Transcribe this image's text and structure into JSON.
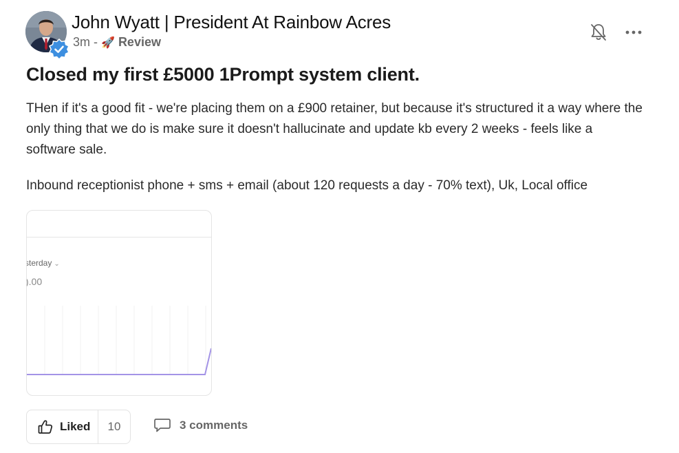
{
  "post": {
    "author": {
      "name": "John Wyatt | President At Rainbow Acres",
      "avatar_icon": "profile-photo",
      "verified_icon": "verified-badge-icon",
      "verified_color": "#3d8fe0"
    },
    "meta": {
      "time_ago": "3m",
      "separator": "-",
      "category_icon": "rocket",
      "category_glyph": "🚀",
      "category": "Review"
    },
    "actions": {
      "notifications_icon": "bell-off-icon",
      "more_icon": "more-horizontal-icon"
    },
    "title": "Closed my first £5000 1Prompt system client.",
    "body": [
      "THen if it's a good fit - we're placing them on a £900 retainer, but because it's structured it a way where the only thing that we do is make sure it doesn't hallucinate and update kb every 2 weeks - feels like a software sale.",
      "Inbound receptionist phone + sms + email (about 120 requests a day - 70% text), Uk, Local office"
    ],
    "attachment": {
      "period_label": "sterday",
      "chevron_glyph": "⌄",
      "amount_label": ").00",
      "line_color": "#a393e6"
    },
    "reactions": {
      "like_label": "Liked",
      "like_count": "10",
      "like_icon": "thumbs-up-icon",
      "comments_label": "3 comments",
      "comments_icon": "comment-icon"
    }
  }
}
